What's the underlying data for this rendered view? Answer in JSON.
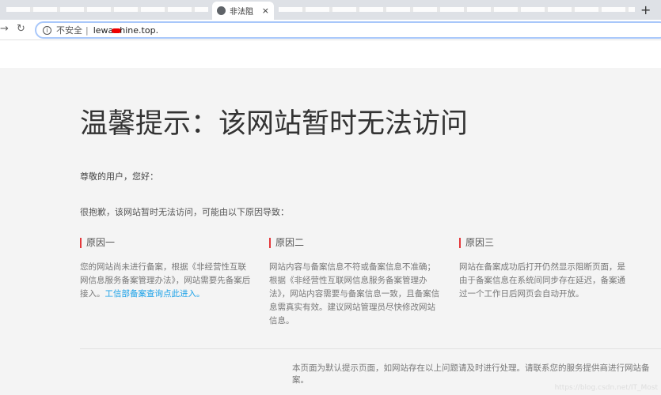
{
  "browser": {
    "tab_title": "非法阻",
    "new_tab": "+",
    "close": "×",
    "address": {
      "security_label": "不安全",
      "url_prefix": "lewa",
      "url_suffix": "hine.top."
    }
  },
  "page": {
    "title": "温馨提示：该网站暂时无法访问",
    "greeting": "尊敬的用户，您好：",
    "intro": "很抱歉，该网站暂时无法访问，可能由以下原因导致：",
    "reasons": [
      {
        "heading": "原因一",
        "text": "您的网站尚未进行备案，根据《非经营性互联网信息服务备案管理办法》，网站需要先备案后接入。",
        "link": "工信部备案查询点此进入。"
      },
      {
        "heading": "原因二",
        "text": "网站内容与备案信息不符或备案信息不准确；根据《非经营性互联网信息服务备案管理办法》，网站内容需要与备案信息一致，且备案信息需真实有效。建议网站管理员尽快修改网站信息。"
      },
      {
        "heading": "原因三",
        "text": "网站在备案成功后打开仍然显示阻断页面，是由于备案信息在系统间同步存在延迟，备案通过一个工作日后网页会自动开放。"
      }
    ],
    "footer": "本页面为默认提示页面，如网站存在以上问题请及时进行处理。请联系您的服务提供商进行网站备案。",
    "watermark": "https://blog.csdn.net/IT_Most"
  },
  "colors": {
    "accent": "#e4393c",
    "link": "#1aa1e8",
    "background": "#f4f4f4"
  }
}
